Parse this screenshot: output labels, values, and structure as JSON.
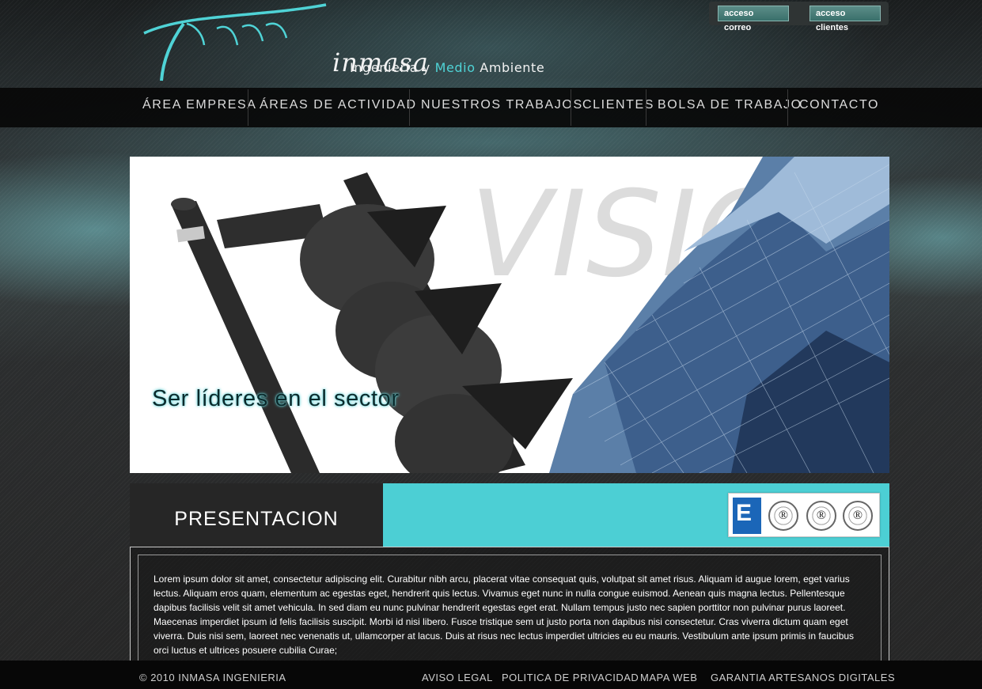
{
  "header": {
    "logo_text": "inmasa",
    "tagline_part1": "Ingeniería y ",
    "tagline_accent": "Medio",
    "tagline_part2": " Ambiente",
    "access_mail": "acceso correo",
    "access_clients": "acceso clientes"
  },
  "nav": {
    "items": [
      {
        "label": "ÁREA EMPRESA"
      },
      {
        "label": "ÁREAS DE ACTIVIDAD"
      },
      {
        "label": "NUESTROS TRABAJOS"
      },
      {
        "label": "CLIENTES"
      },
      {
        "label": "BOLSA DE TRABAJO"
      },
      {
        "label": "CONTACTO"
      }
    ]
  },
  "banner": {
    "watermark": "VISIO",
    "caption": "Ser líderes en el sector"
  },
  "presentation": {
    "title": "PRESENTACION",
    "certifications": [
      {
        "label": "E"
      },
      {
        "label": "®"
      },
      {
        "label": "®"
      },
      {
        "label": "®"
      }
    ],
    "body": "Lorem ipsum dolor sit amet, consectetur adipiscing elit. Curabitur nibh arcu, placerat vitae consequat quis, volutpat sit amet risus. Aliquam id augue lorem, eget varius lectus. Aliquam eros quam, elementum ac egestas eget, hendrerit quis lectus. Vivamus eget nunc in nulla congue euismod. Aenean quis magna lectus. Pellentesque dapibus facilisis velit sit amet vehicula. In sed diam eu nunc pulvinar hendrerit egestas eget erat. Nullam tempus justo nec sapien porttitor non pulvinar purus laoreet. Maecenas imperdiet ipsum id felis facilisis suscipit. Morbi id nisi libero. Fusce tristique sem ut justo porta non dapibus nisi consectetur. Cras viverra dictum quam eget viverra. Duis nisi sem, laoreet nec venenatis ut, ullamcorper at lacus. Duis at risus nec lectus imperdiet ultricies eu eu mauris. Vestibulum ante ipsum primis in faucibus orci luctus et ultrices posuere cubilia Curae;"
  },
  "footer": {
    "copyright": "© 2010 INMASA INGENIERIA",
    "links": [
      {
        "label": "AVISO LEGAL"
      },
      {
        "label": "POLITICA DE PRIVACIDAD"
      },
      {
        "label": "MAPA WEB"
      },
      {
        "label": "GARANTIA ARTESANOS DIGITALES"
      }
    ]
  },
  "colors": {
    "accent": "#4ccfd4",
    "nav_bg": "#080808",
    "title_bg": "#262626"
  }
}
